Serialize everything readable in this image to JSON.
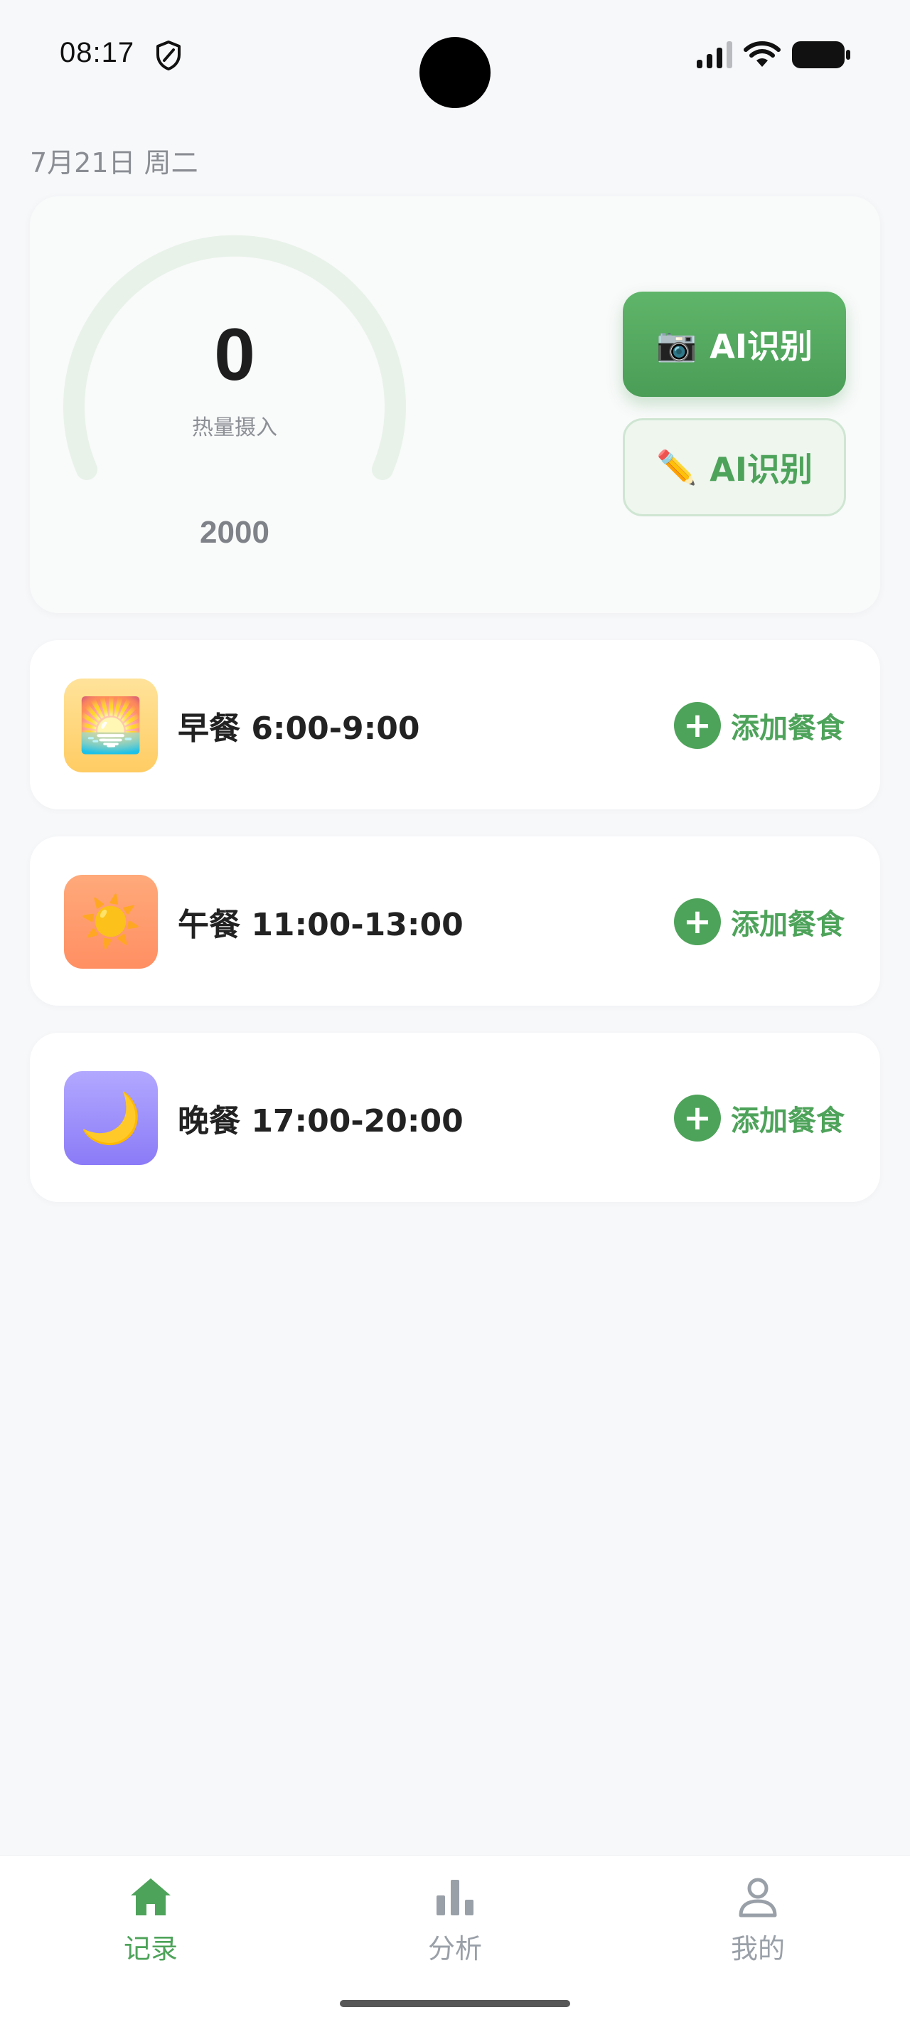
{
  "status_bar": {
    "time": "08:17"
  },
  "date": "7月21日 周二",
  "summary": {
    "calories_value": "0",
    "calories_label": "热量摄入",
    "goal_value": "2000",
    "ai_photo_label": "AI识别",
    "ai_photo_icon": "📷",
    "ai_text_label": "AI识别",
    "ai_text_icon": "✏️",
    "progress_fraction": 0
  },
  "meals": [
    {
      "title": "早餐 6:00-9:00",
      "icon": "🌅",
      "icon_name": "sunrise-icon",
      "add_label": "添加餐食"
    },
    {
      "title": "午餐 11:00-13:00",
      "icon": "☀️",
      "icon_name": "sun-icon",
      "add_label": "添加餐食"
    },
    {
      "title": "晚餐 17:00-20:00",
      "icon": "🌙",
      "icon_name": "moon-icon",
      "add_label": "添加餐食"
    }
  ],
  "bottom_nav": [
    {
      "label": "记录",
      "icon": "home-icon",
      "active": true
    },
    {
      "label": "分析",
      "icon": "bar-chart-icon",
      "active": false
    },
    {
      "label": "我的",
      "icon": "user-icon",
      "active": false
    }
  ],
  "colors": {
    "accent": "#4ea35a",
    "gauge_track": "#e8f2e9",
    "inactive_nav": "#9aa0a8",
    "background": "#f7f8fa"
  }
}
